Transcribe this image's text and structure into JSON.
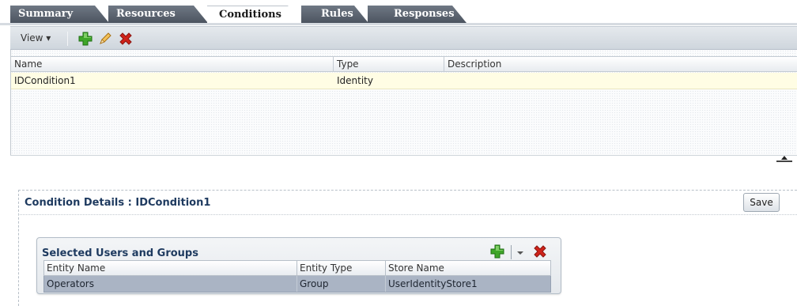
{
  "tabs": [
    {
      "label": "Summary",
      "active": false
    },
    {
      "label": "Resources",
      "active": false
    },
    {
      "label": "Conditions",
      "active": true
    },
    {
      "label": "Rules",
      "active": false
    },
    {
      "label": "Responses",
      "active": false
    }
  ],
  "toolbar": {
    "view_label": "View ▾",
    "icons": [
      "add-icon",
      "edit-icon",
      "delete-icon"
    ]
  },
  "conditions_table": {
    "columns": [
      "Name",
      "Type",
      "Description"
    ],
    "rows": [
      {
        "name": "IDCondition1",
        "type": "Identity",
        "description": ""
      }
    ]
  },
  "details": {
    "title": "Condition Details : IDCondition1",
    "save_label": "Save"
  },
  "selected": {
    "title": "Selected Users and Groups",
    "columns": [
      "Entity Name",
      "Entity Type",
      "Store Name"
    ],
    "rows": [
      {
        "entity_name": "Operators",
        "entity_type": "Group",
        "store_name": "UserIdentityStore1"
      }
    ]
  },
  "colors": {
    "tab_inactive": "#5a636e",
    "selected_row": "#aab4c4",
    "title_text": "#1e3a5f",
    "add_green": "#3fa629",
    "delete_red": "#d0231a"
  }
}
